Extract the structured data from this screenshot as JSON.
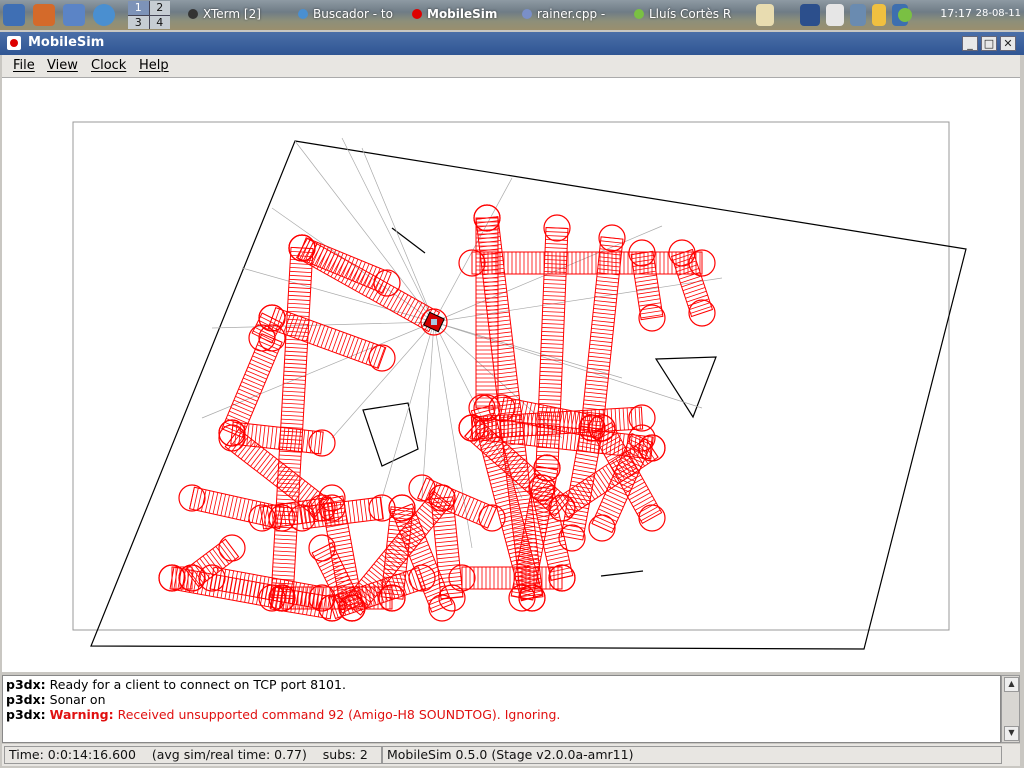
{
  "taskbar": {
    "pager": [
      "1",
      "2",
      "3",
      "4"
    ],
    "tasks": [
      {
        "label": "XTerm [2]",
        "icon": "terminal-icon"
      },
      {
        "label": "Buscador - to",
        "icon": "browser-icon"
      },
      {
        "label": "MobileSim",
        "icon": "mobilesim-icon"
      },
      {
        "label": "rainer.cpp -",
        "icon": "editor-icon"
      },
      {
        "label": "Lluís Cortès R",
        "icon": "chat-icon"
      }
    ],
    "clock": "17:17",
    "date": "28-08-11"
  },
  "window": {
    "title": "MobileSim",
    "controls": {
      "minimize": "_",
      "maximize": "□",
      "close": "✕"
    }
  },
  "menu": [
    "File",
    "View",
    "Clock",
    "Help"
  ],
  "log": [
    {
      "prefix": "p3dx:",
      "text": "Ready for a client to connect on TCP port 8101."
    },
    {
      "prefix": "p3dx:",
      "text": "Sonar on"
    },
    {
      "prefix": "p3dx:",
      "warning": "Warning:",
      "text": "Received unsupported command 92 (Amigo-H8 SOUNDTOG). Ignoring."
    }
  ],
  "status": {
    "time": "Time: 0:0:14:16.600",
    "avg": "(avg sim/real time: 0.77)",
    "subs": "subs: 2",
    "version": "MobileSim 0.5.0 (Stage v2.0.0a-amr11)"
  },
  "colors": {
    "trail": "#ff0000",
    "titlebar": "#2f5593",
    "warning": "#e01010"
  }
}
